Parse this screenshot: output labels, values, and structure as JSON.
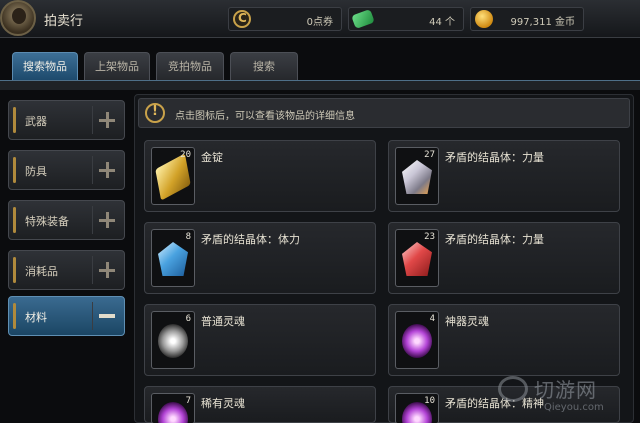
{
  "header": {
    "title": "拍卖行",
    "points": "0点券",
    "gems": "44 个",
    "gold": "997,311 金币"
  },
  "tabs": [
    {
      "label": "搜索物品",
      "active": true
    },
    {
      "label": "上架物品",
      "active": false
    },
    {
      "label": "竞拍物品",
      "active": false
    },
    {
      "label": "搜索",
      "active": false
    }
  ],
  "categories": [
    {
      "label": "武器",
      "state": "collapsed"
    },
    {
      "label": "防具",
      "state": "collapsed"
    },
    {
      "label": "特殊装备",
      "state": "collapsed"
    },
    {
      "label": "消耗品",
      "state": "collapsed"
    },
    {
      "label": "材料",
      "state": "expanded"
    }
  ],
  "notice": "点击图标后，可以查看该物品的详细信息",
  "items": [
    {
      "name": "金锭",
      "qty": "20",
      "icon": "gold-ingot-icon"
    },
    {
      "name": "矛盾的结晶体：力量",
      "qty": "27",
      "icon": "white-crystal-icon"
    },
    {
      "name": "矛盾的结晶体：体力",
      "qty": "8",
      "icon": "blue-crystal-icon"
    },
    {
      "name": "矛盾的结晶体：力量",
      "qty": "23",
      "icon": "red-crystal-icon"
    },
    {
      "name": "普通灵魂",
      "qty": "6",
      "icon": "white-soul-icon"
    },
    {
      "name": "神器灵魂",
      "qty": "4",
      "icon": "purple-soul-icon"
    },
    {
      "name": "稀有灵魂",
      "qty": "7",
      "icon": "purple-soul-icon"
    },
    {
      "name": "矛盾的结晶体：精神",
      "qty": "10",
      "icon": "crystal-icon"
    }
  ],
  "watermark": {
    "main": "切游网",
    "sub": "Qieyou.com"
  }
}
